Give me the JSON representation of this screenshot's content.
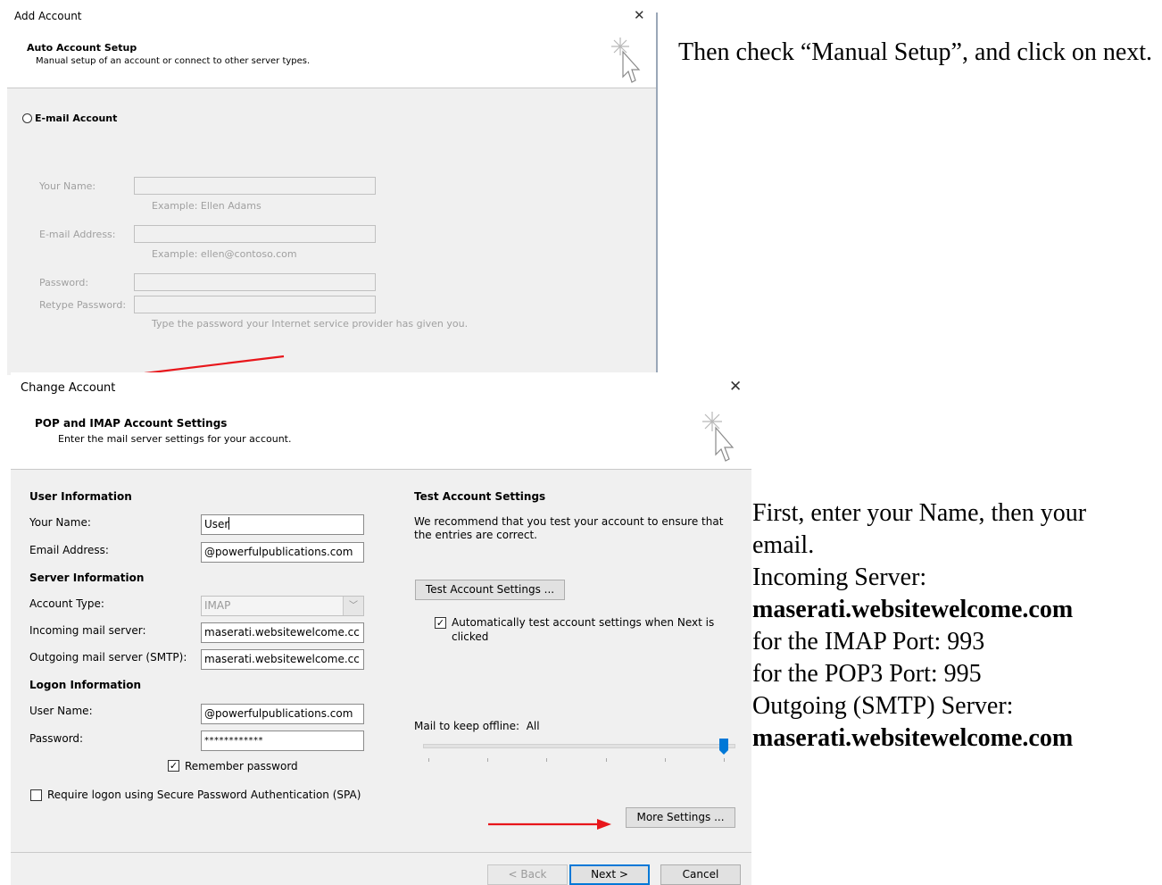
{
  "dialog1": {
    "title": "Add Account",
    "header_title": "Auto Account Setup",
    "header_subtitle": "Manual setup of an account or connect to other server types.",
    "radio_label": "E-mail Account",
    "fields": [
      {
        "label": "Your Name:",
        "hint": "Example: Ellen Adams"
      },
      {
        "label": "E-mail Address:",
        "hint": "Example: ellen@contoso.com"
      },
      {
        "label": "Password:",
        "hint": ""
      },
      {
        "label": "Retype Password:",
        "hint": "Type the password your Internet service provider has given you."
      }
    ]
  },
  "dialog2": {
    "title": "Change Account",
    "header_title": "POP and IMAP Account Settings",
    "header_subtitle": "Enter the mail server settings for your account.",
    "user_info": {
      "heading": "User Information",
      "name_label": "Your Name:",
      "name_value": "User",
      "email_label": "Email Address:",
      "email_value": "@powerfulpublications.com"
    },
    "server_info": {
      "heading": "Server Information",
      "account_type_label": "Account Type:",
      "account_type_value": "IMAP",
      "incoming_label": "Incoming mail server:",
      "incoming_value": "maserati.websitewelcome.cc",
      "outgoing_label": "Outgoing mail server (SMTP):",
      "outgoing_value": "maserati.websitewelcome.cc"
    },
    "logon_info": {
      "heading": "Logon Information",
      "username_label": "User Name:",
      "username_value": "@powerfulpublications.com",
      "password_label": "Password:",
      "password_value": "************",
      "remember_label": "Remember password",
      "remember_checked": true,
      "spa_label": "Require logon using Secure Password Authentication (SPA)",
      "spa_checked": false
    },
    "test": {
      "heading": "Test Account Settings",
      "description": "We recommend that you test your account to ensure that the entries are correct.",
      "button": "Test Account Settings ...",
      "auto_test_label": "Automatically test account settings when Next is clicked",
      "auto_test_checked": true
    },
    "offline": {
      "label": "Mail to keep offline:",
      "value": "All",
      "slider_level": 1.0
    },
    "more_settings_button": "More Settings ...",
    "back_button": "< Back",
    "next_button": "Next >",
    "cancel_button": "Cancel",
    "accent_color": "#0078d7",
    "arrow_color": "#e8161b"
  },
  "instructions": {
    "step1": "Then check “Manual Setup”, and click on next.",
    "step2_line1": "First, enter your Name, then your email.",
    "incoming_label": "Incoming Server:",
    "incoming_server": "maserati.websitewelcome.com",
    "imap_port": "for the IMAP Port: 993",
    "pop3_port": "for the POP3 Port: 995",
    "outgoing_label": "Outgoing (SMTP) Server:",
    "outgoing_server": "maserati.websitewelcome.com"
  }
}
